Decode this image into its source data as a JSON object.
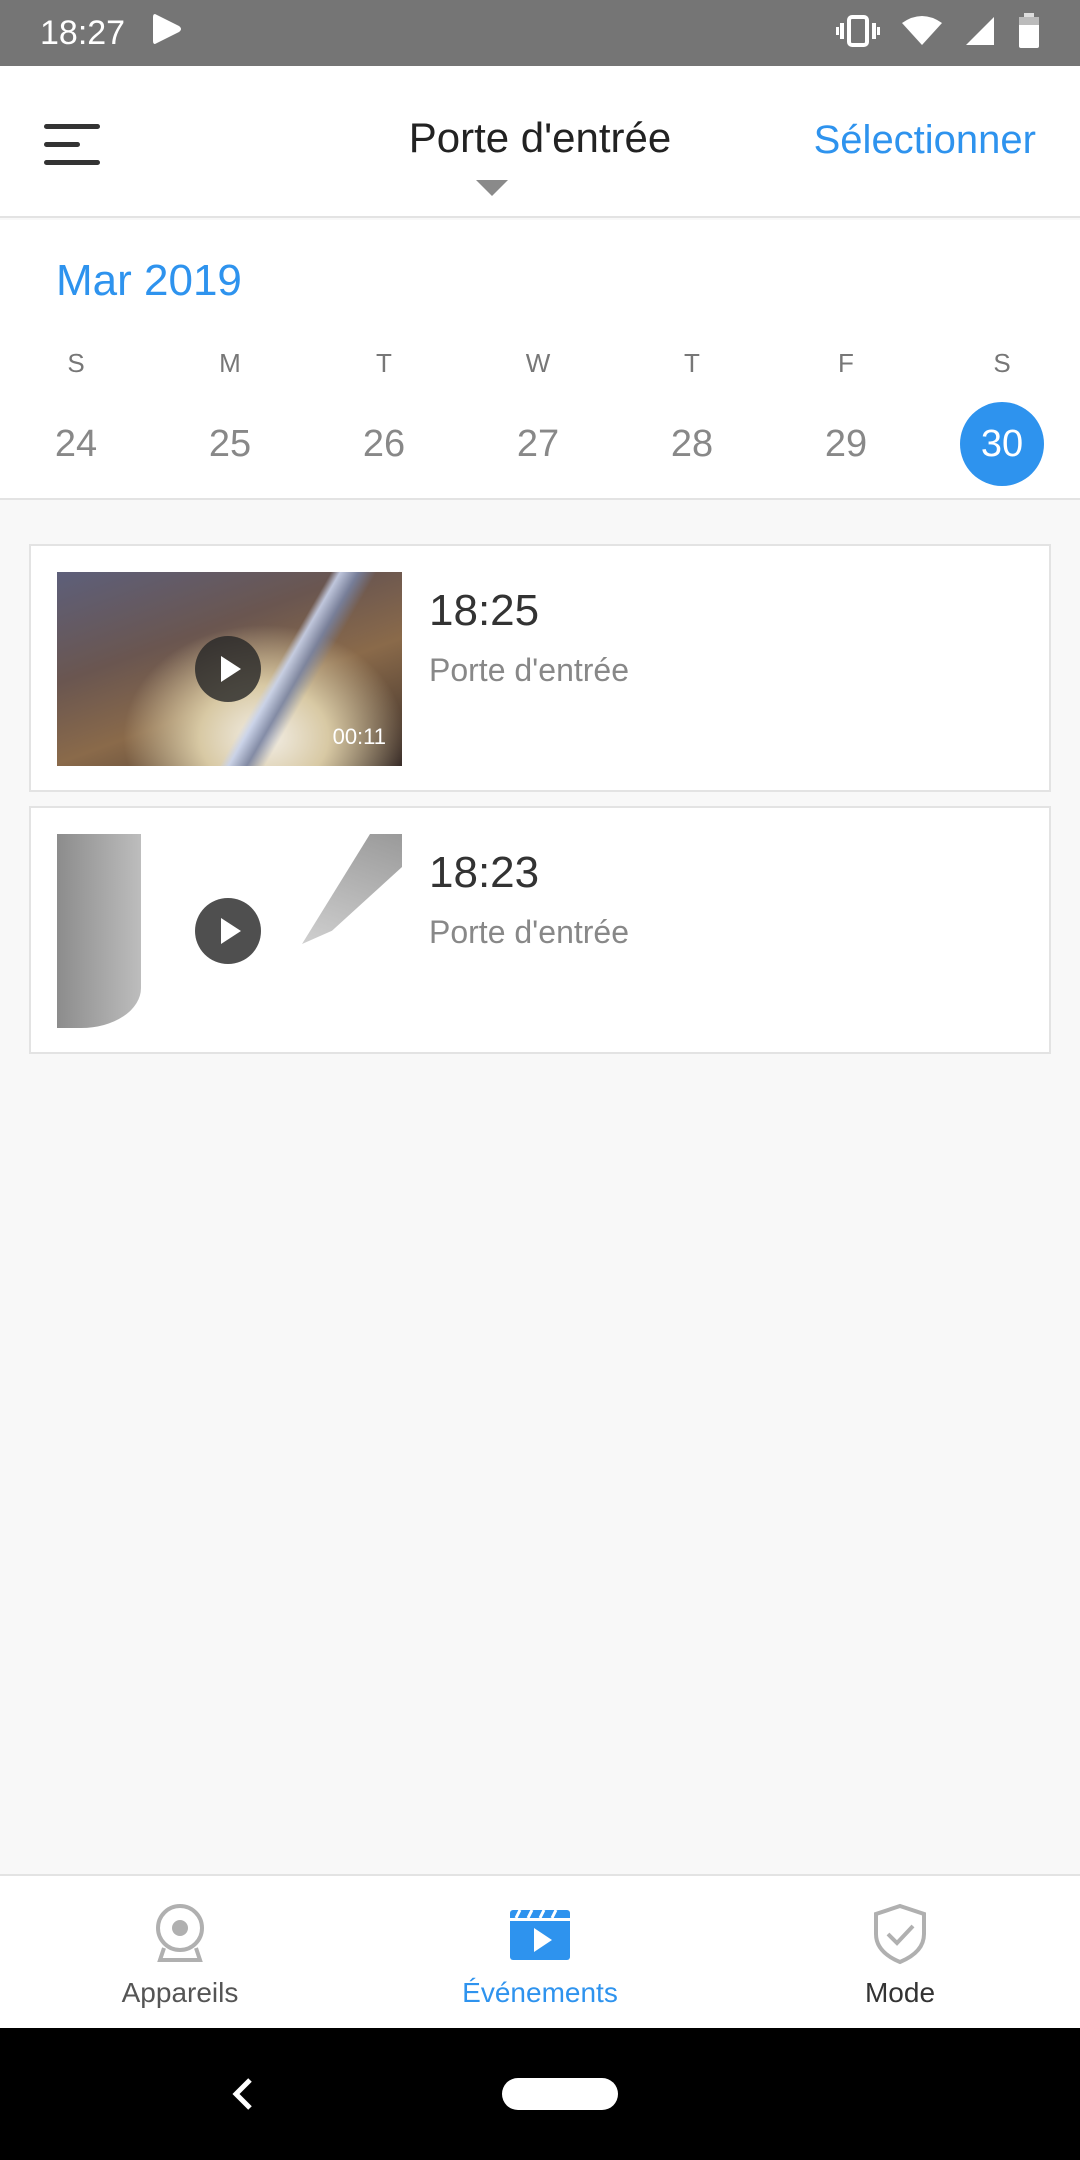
{
  "status_bar": {
    "time": "18:27",
    "icons": [
      "play-store-icon",
      "vibrate-icon",
      "wifi-icon",
      "cell-signal-icon",
      "battery-icon"
    ]
  },
  "app_bar": {
    "title": "Porte d'entrée",
    "select_label": "Sélectionner"
  },
  "calendar": {
    "month": "Mar 2019",
    "days": [
      {
        "letter": "S",
        "number": "24",
        "selected": false
      },
      {
        "letter": "M",
        "number": "25",
        "selected": false
      },
      {
        "letter": "T",
        "number": "26",
        "selected": false
      },
      {
        "letter": "W",
        "number": "27",
        "selected": false
      },
      {
        "letter": "T",
        "number": "28",
        "selected": false
      },
      {
        "letter": "F",
        "number": "29",
        "selected": false
      },
      {
        "letter": "S",
        "number": "30",
        "selected": true
      }
    ]
  },
  "events": [
    {
      "time": "18:25",
      "source": "Porte d'entrée",
      "duration": "00:11"
    },
    {
      "time": "18:23",
      "source": "Porte d'entrée",
      "duration": ""
    }
  ],
  "bottom_nav": {
    "items": [
      {
        "label": "Appareils",
        "icon": "camera-icon",
        "active": false
      },
      {
        "label": "Événements",
        "icon": "events-video-icon",
        "active": true
      },
      {
        "label": "Mode",
        "icon": "shield-check-icon",
        "active": false
      }
    ]
  },
  "colors": {
    "accent": "#2e93ee",
    "status_bar": "#757575",
    "inactive_icon": "#b0b0b0"
  }
}
